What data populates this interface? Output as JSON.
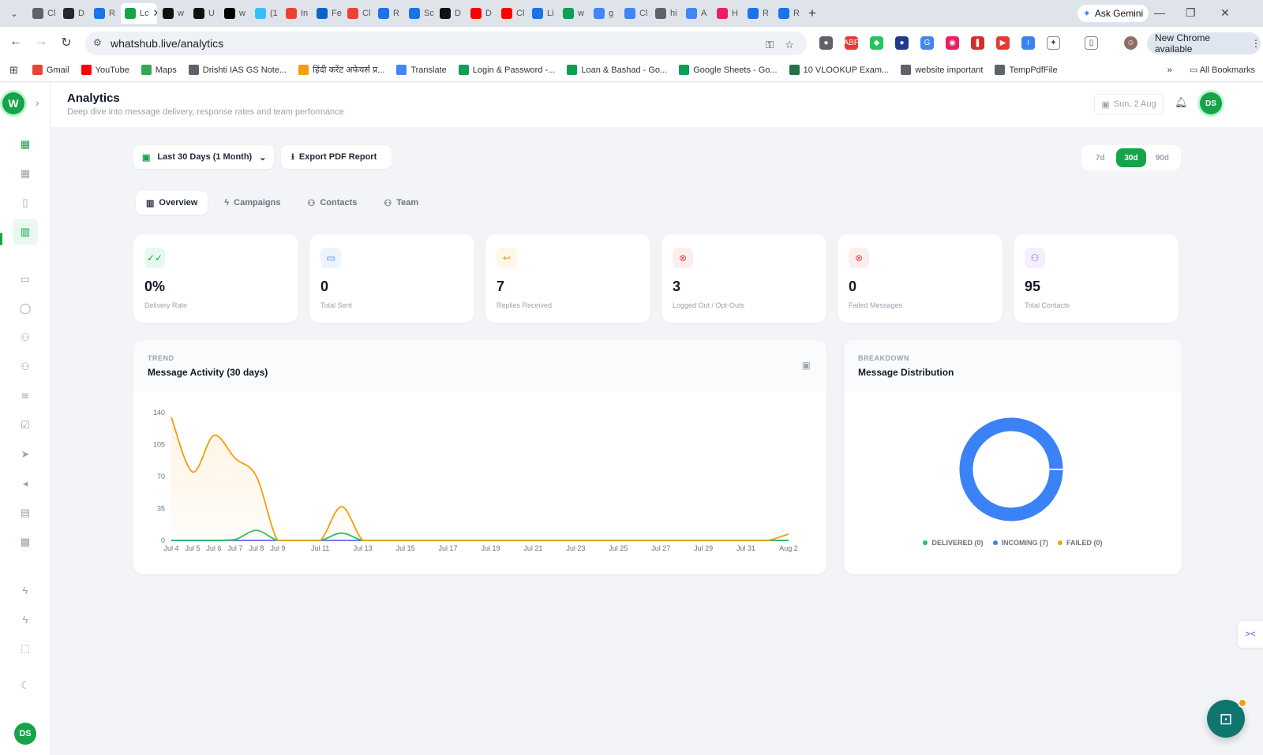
{
  "browser": {
    "tabs": [
      {
        "label": "Cl",
        "color": "#5f6368"
      },
      {
        "label": "D",
        "color": "#24292f"
      },
      {
        "label": "R",
        "color": "#1a73e8"
      },
      {
        "label": "Lc",
        "color": "#16a34a",
        "active": true
      },
      {
        "label": "w",
        "color": "#111"
      },
      {
        "label": "U",
        "color": "#111"
      },
      {
        "label": "w",
        "color": "#000"
      },
      {
        "label": "(1",
        "color": "#38bdf8"
      },
      {
        "label": "In",
        "color": "#ea4335"
      },
      {
        "label": "Fe",
        "color": "#0a66c2"
      },
      {
        "label": "Cl",
        "color": "#ea4335"
      },
      {
        "label": "R",
        "color": "#1a73e8"
      },
      {
        "label": "Sc",
        "color": "#1a73e8"
      },
      {
        "label": "D",
        "color": "#111"
      },
      {
        "label": "D",
        "color": "#ff0000"
      },
      {
        "label": "Cl",
        "color": "#ff0000"
      },
      {
        "label": "Li",
        "color": "#1a73e8"
      },
      {
        "label": "w",
        "color": "#0f9d58"
      },
      {
        "label": "g",
        "color": "#4285f4"
      },
      {
        "label": "Cl",
        "color": "#4285f4"
      },
      {
        "label": "hi",
        "color": "#5f6368"
      },
      {
        "label": "A",
        "color": "#4285f4"
      },
      {
        "label": "H",
        "color": "#e91e63"
      },
      {
        "label": "R",
        "color": "#1a73e8"
      },
      {
        "label": "R",
        "color": "#1a73e8"
      }
    ],
    "close_glyph": "✕",
    "new_tab": "+",
    "gemini_label": "Ask Gemini",
    "url": "whatshub.live/analytics",
    "chrome_update": "New Chrome available",
    "bookmarks": [
      {
        "label": "Gmail",
        "color": "#ea4335"
      },
      {
        "label": "YouTube",
        "color": "#ff0000"
      },
      {
        "label": "Maps",
        "color": "#34a853"
      },
      {
        "label": "Drishti IAS GS Note...",
        "color": "#5f6368"
      },
      {
        "label": "हिंदी करेंट अफेयर्स प्र...",
        "color": "#f59e0b"
      },
      {
        "label": "Translate",
        "color": "#4285f4"
      },
      {
        "label": "Login & Password -...",
        "color": "#0f9d58"
      },
      {
        "label": "Loan & Bashad - Go...",
        "color": "#0f9d58"
      },
      {
        "label": "Google Sheets - Go...",
        "color": "#0f9d58"
      },
      {
        "label": "10 VLOOKUP Exam...",
        "color": "#217346"
      },
      {
        "label": "website important",
        "color": "#5f6368"
      },
      {
        "label": "TempPdfFile",
        "color": "#5f6368"
      }
    ],
    "all_bookmarks": "All Bookmarks"
  },
  "app": {
    "logo_letter": "W",
    "user_initials": "DS",
    "header": {
      "title": "Analytics",
      "subtitle": "Deep dive into message delivery, response rates and team performance",
      "date": "Sun, 2 Aug"
    },
    "toolbar": {
      "range_label": "Last 30 Days (1 Month)",
      "export_label": "Export PDF Report",
      "periods": [
        "7d",
        "30d",
        "90d"
      ],
      "active_period": "30d"
    },
    "tabs": [
      {
        "label": "Overview",
        "icon": "bar-chart-icon",
        "active": true
      },
      {
        "label": "Campaigns",
        "icon": "lightning-icon"
      },
      {
        "label": "Contacts",
        "icon": "users-icon"
      },
      {
        "label": "Team",
        "icon": "team-icon"
      }
    ],
    "stats": [
      {
        "value": "0%",
        "label": "Delivery Rate",
        "icon": "check-double-icon",
        "color": "#16a34a",
        "bg": "#e8f8ef",
        "glyph": "✓✓"
      },
      {
        "value": "0",
        "label": "Total Sent",
        "icon": "message-square-icon",
        "color": "#3b82f6",
        "bg": "#eef4ff",
        "glyph": "▭"
      },
      {
        "value": "7",
        "label": "Replies Received",
        "icon": "reply-icon",
        "color": "#f59e0b",
        "bg": "#fff7e8",
        "glyph": "↩"
      },
      {
        "value": "3",
        "label": "Logged Out / Opt-Outs",
        "icon": "x-circle-icon",
        "color": "#ef4444",
        "bg": "#fdeeee",
        "glyph": "⊗"
      },
      {
        "value": "0",
        "label": "Failed Messages",
        "icon": "x-circle-icon",
        "color": "#ef4444",
        "bg": "#fdeeee",
        "glyph": "⊗"
      },
      {
        "value": "95",
        "label": "Total Contacts",
        "icon": "users-icon",
        "color": "#8b5cf6",
        "bg": "#f4efff",
        "glyph": "⚇"
      }
    ],
    "trend": {
      "eyebrow": "TREND",
      "title": "Message Activity (30 days)"
    },
    "breakdown": {
      "eyebrow": "BREAKDOWN",
      "title": "Message Distribution",
      "legend": [
        {
          "label": "DELIVERED (0)",
          "color": "#22c55e"
        },
        {
          "label": "INCOMING (7)",
          "color": "#3b82f6"
        },
        {
          "label": "FAILED (0)",
          "color": "#f59e0b"
        }
      ]
    }
  },
  "chart_data": [
    {
      "type": "area",
      "x": [
        "Jul 4",
        "Jul 5",
        "Jul 6",
        "Jul 7",
        "Jul 8",
        "Jul 9",
        "Jul 10",
        "Jul 11",
        "Jul 12",
        "Jul 13",
        "Jul 14",
        "Jul 15",
        "Jul 16",
        "Jul 17",
        "Jul 18",
        "Jul 19",
        "Jul 20",
        "Jul 21",
        "Jul 22",
        "Jul 23",
        "Jul 24",
        "Jul 25",
        "Jul 26",
        "Jul 27",
        "Jul 28",
        "Jul 29",
        "Jul 30",
        "Jul 31",
        "Aug 1",
        "Aug 2"
      ],
      "x_tick_labels": [
        "Jul 4",
        "Jul 5",
        "Jul 6",
        "Jul 7",
        "Jul 8",
        "Jul 9",
        "Jul 11",
        "Jul 13",
        "Jul 15",
        "Jul 17",
        "Jul 19",
        "Jul 21",
        "Jul 23",
        "Jul 25",
        "Jul 27",
        "Jul 29",
        "Jul 31",
        "Aug 2"
      ],
      "y_ticks": [
        0,
        35,
        70,
        105,
        140
      ],
      "ylim": [
        0,
        140
      ],
      "grid": false,
      "series": [
        {
          "color": "#f59e0b",
          "fill": true,
          "values": [
            135,
            75,
            115,
            90,
            70,
            0,
            0,
            0,
            37,
            0,
            0,
            0,
            0,
            0,
            0,
            0,
            0,
            0,
            0,
            0,
            0,
            0,
            0,
            0,
            0,
            0,
            0,
            0,
            0,
            7
          ]
        },
        {
          "color": "#22c55e",
          "fill": false,
          "values": [
            0,
            0,
            0,
            1,
            11,
            0,
            0,
            0,
            8,
            0,
            0,
            0,
            0,
            0,
            0,
            0,
            0,
            0,
            0,
            0,
            0,
            0,
            0,
            0,
            0,
            0,
            0,
            0,
            0,
            0
          ]
        },
        {
          "color": "#6366f1",
          "fill": false,
          "values": [
            0,
            0,
            0,
            0,
            0,
            0,
            0,
            0,
            0,
            0,
            0,
            0,
            0,
            0,
            0,
            0,
            0,
            0,
            0,
            0,
            0,
            0,
            0,
            0,
            0,
            0,
            0,
            0,
            0,
            0
          ]
        }
      ]
    },
    {
      "type": "pie",
      "categories": [
        "DELIVERED",
        "INCOMING",
        "FAILED"
      ],
      "values": [
        0,
        7,
        0
      ],
      "colors": [
        "#22c55e",
        "#3b82f6",
        "#f59e0b"
      ]
    }
  ]
}
